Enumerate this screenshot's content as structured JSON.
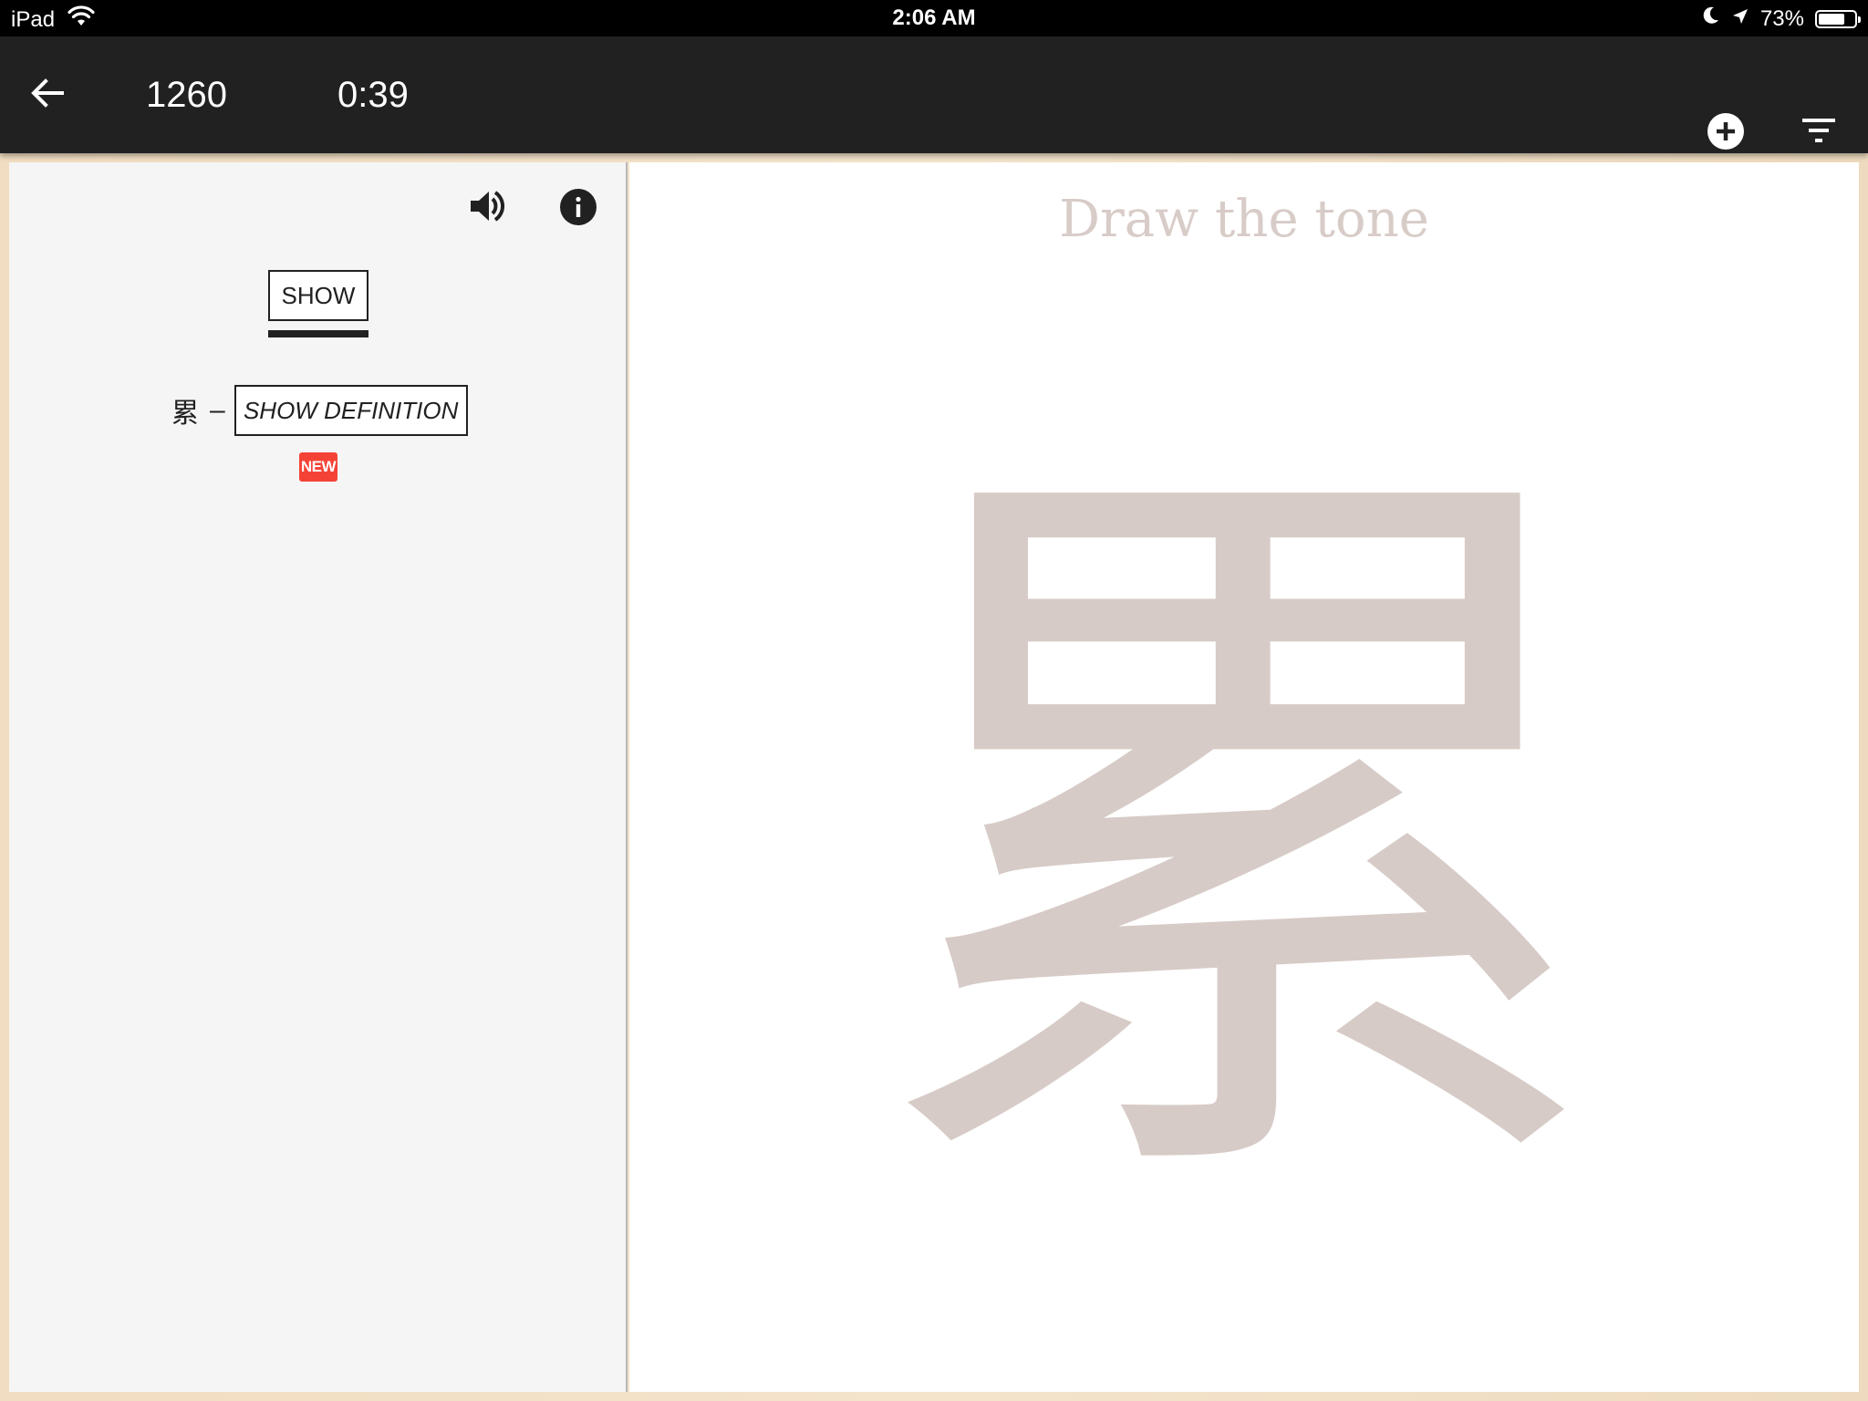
{
  "status_bar": {
    "device": "iPad",
    "time": "2:06 AM",
    "battery": "73%",
    "battery_level": 0.73,
    "icons": [
      "wifi-icon",
      "moon-icon",
      "location-arrow-icon",
      "battery-icon"
    ]
  },
  "toolbar": {
    "count": "1260",
    "timer": "0:39",
    "icons": [
      "arrow-left-icon",
      "plus-circle-icon",
      "filter-icon"
    ]
  },
  "left_panel": {
    "show_label": "SHOW",
    "character": "累",
    "dash": "–",
    "show_definition_label": "SHOW DEFINITION",
    "new_badge": "NEW",
    "icons": [
      "speaker-icon",
      "info-icon"
    ]
  },
  "canvas": {
    "prompt": "Draw the tone",
    "guide_character": "累"
  },
  "colors": {
    "toolbar_bg": "#212121",
    "badge": "#f44336",
    "guide": "#d7cbc7"
  }
}
